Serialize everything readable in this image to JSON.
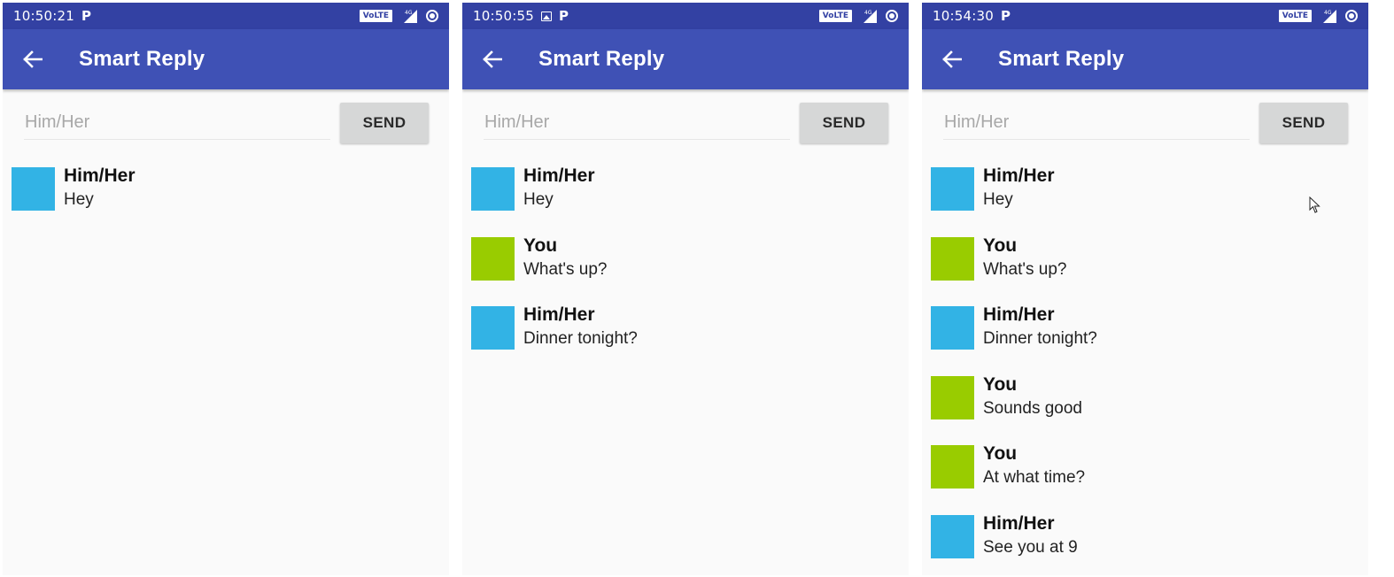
{
  "colors": {
    "status_bar": "#3341a3",
    "app_bar": "#3f51b5",
    "him_her_avatar": "#32b3e5",
    "you_avatar": "#99cc00",
    "send_button": "#d6d7d7"
  },
  "icons": {
    "back": "back-arrow-icon",
    "notification": "p-icon",
    "image": "image-icon",
    "volte": "volte-icon",
    "signal": "signal-icon",
    "data_saver": "circle-icon",
    "pointer": "mouse-cursor-icon"
  },
  "panels": [
    {
      "status": {
        "time": "10:50:21",
        "volte": "VoLTE"
      },
      "title": "Smart Reply",
      "input_placeholder": "Him/Her",
      "send_label": "SEND",
      "messages": [
        {
          "sender": "Him/Her",
          "text": "Hey",
          "kind": "him"
        }
      ]
    },
    {
      "status": {
        "time": "10:50:55",
        "volte": "VoLTE"
      },
      "title": "Smart Reply",
      "input_placeholder": "Him/Her",
      "send_label": "SEND",
      "messages": [
        {
          "sender": "Him/Her",
          "text": "Hey",
          "kind": "him"
        },
        {
          "sender": "You",
          "text": "What's up?",
          "kind": "you"
        },
        {
          "sender": "Him/Her",
          "text": "Dinner tonight?",
          "kind": "him"
        }
      ]
    },
    {
      "status": {
        "time": "10:54:30",
        "volte": "VoLTE"
      },
      "title": "Smart Reply",
      "input_placeholder": "Him/Her",
      "send_label": "SEND",
      "messages": [
        {
          "sender": "Him/Her",
          "text": "Hey",
          "kind": "him"
        },
        {
          "sender": "You",
          "text": "What's up?",
          "kind": "you"
        },
        {
          "sender": "Him/Her",
          "text": "Dinner tonight?",
          "kind": "him"
        },
        {
          "sender": "You",
          "text": "Sounds good",
          "kind": "you"
        },
        {
          "sender": "You",
          "text": "At what time?",
          "kind": "you"
        },
        {
          "sender": "Him/Her",
          "text": "See you at 9",
          "kind": "him"
        }
      ]
    }
  ]
}
